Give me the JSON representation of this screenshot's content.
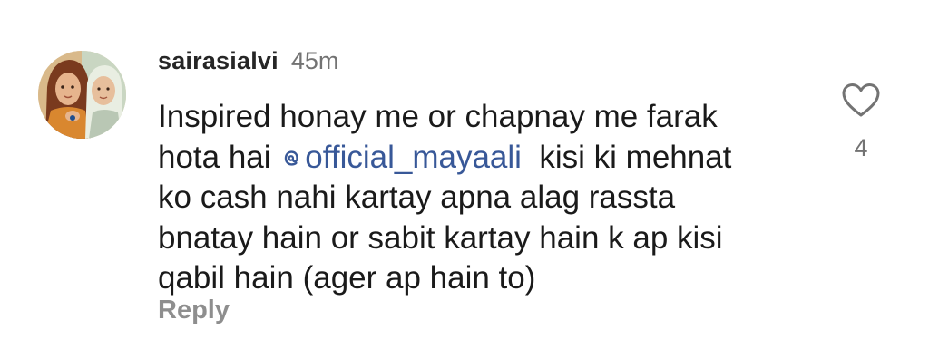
{
  "comment": {
    "username": "sairasialvi",
    "timestamp": "45m",
    "text_lines": [
      "Inspired honay me or chapnay me farak",
      "kisi ki mehnat",
      "ko cash nahi kartay apna alag rassta",
      "bnatay hain or sabit kartay hain k ap kisi",
      "qabil hain (ager ap hain to)"
    ],
    "line2_prefix": "hota hai ",
    "mention": "official_mayaali",
    "mention_icon": "threads-at-icon",
    "reply_label": "Reply",
    "like_count": "4",
    "like_icon": "heart-outline-icon",
    "avatar_icon": "avatar-illustration"
  },
  "colors": {
    "mention": "#385898",
    "muted": "#737373",
    "reply": "#8e8e8e"
  }
}
